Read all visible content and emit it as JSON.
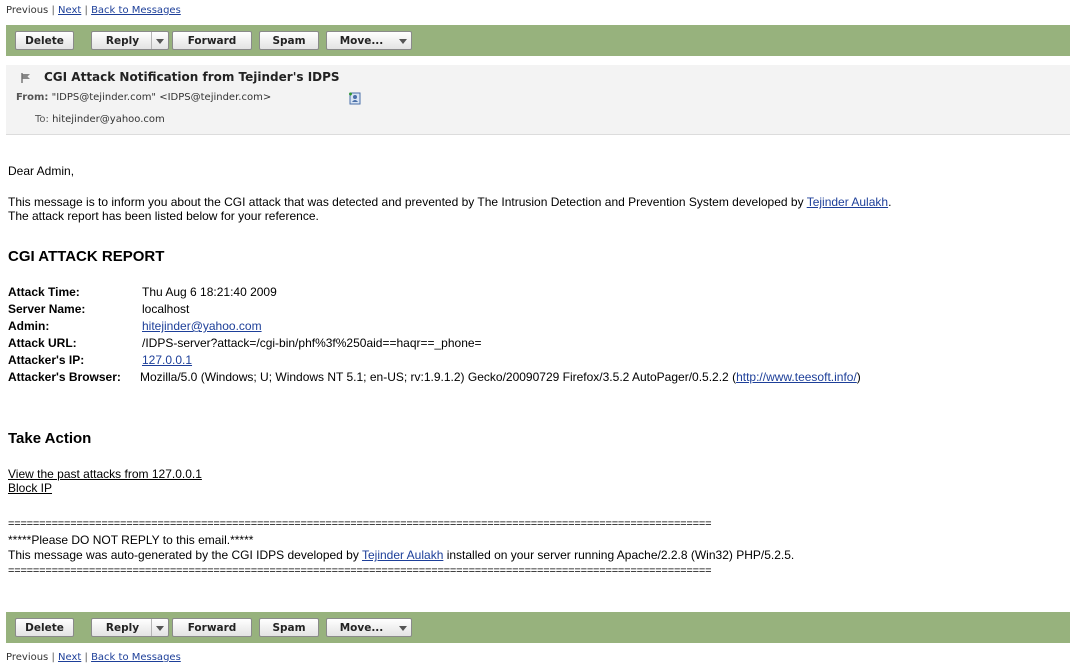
{
  "nav": {
    "previous": "Previous",
    "sep": "|",
    "next": "Next",
    "back": "Back to Messages"
  },
  "toolbar": {
    "delete": "Delete",
    "reply": "Reply",
    "forward": "Forward",
    "spam": "Spam",
    "move": "Move..."
  },
  "message": {
    "subject": "CGI Attack Notification from Tejinder's IDPS",
    "from_label": "From:",
    "from_value": "\"IDPS@tejinder.com\" <IDPS@tejinder.com>",
    "to_label": "To:",
    "to_value": "hitejinder@yahoo.com"
  },
  "body": {
    "greeting": "Dear Admin,",
    "intro_1": "This message is to inform you about the CGI attack that was detected and prevented by The Intrusion Detection and Prevention System developed by ",
    "intro_link": "Tejinder Aulakh",
    "intro_1_end": ".",
    "intro_2": "The attack report has been listed below for your reference.",
    "report_heading": "CGI ATTACK REPORT",
    "report": {
      "time_label": "Attack Time:",
      "time_value": "Thu Aug 6 18:21:40 2009",
      "server_label": "Server Name:",
      "server_value": "localhost",
      "admin_label": "Admin:",
      "admin_value": "hitejinder@yahoo.com",
      "url_label": "Attack URL:",
      "url_value": "/IDPS-server?attack=/cgi-bin/phf%3f%250aid==haqr==_phone=",
      "ip_label": "Attacker's IP:",
      "ip_value": "127.0.0.1",
      "browser_label": "Attacker's Browser:",
      "browser_value": "Mozilla/5.0 (Windows; U; Windows NT 5.1; en-US; rv:1.9.1.2) Gecko/20090729 Firefox/3.5.2 AutoPager/0.5.2.2 (",
      "browser_link": "http://www.teesoft.info/",
      "browser_end": ")"
    },
    "action_heading": "Take Action",
    "action_view": "View the past attacks from 127.0.0.1",
    "action_block": "Block IP",
    "rule": "=================================================================================================================",
    "noreply": "*****Please DO NOT REPLY to this email.*****",
    "footer_1": "This message was auto-generated by the CGI IDPS developed by ",
    "footer_link": "Tejinder Aulakh",
    "footer_2": " installed on your server running Apache/2.2.8 (Win32) PHP/5.2.5."
  },
  "colors": {
    "toolbar_bg": "#97b27d",
    "link": "#1d3f99",
    "header_bg": "#f3f3f3"
  },
  "icons": {
    "flag": "flag-icon",
    "address_book": "add-contact-icon",
    "dropdown": "chevron-down-icon"
  }
}
